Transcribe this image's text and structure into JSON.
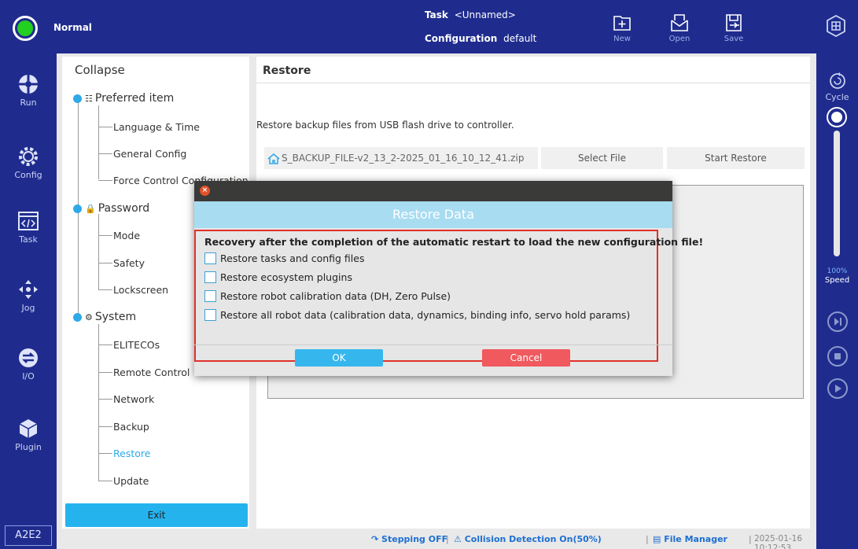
{
  "topbar": {
    "status": "Normal",
    "task_label": "Task",
    "task_value": "<Unnamed>",
    "config_label": "Configuration",
    "config_value": "default",
    "buttons": {
      "new": "New",
      "open": "Open",
      "save": "Save"
    }
  },
  "leftnav": {
    "items": [
      {
        "label": "Run",
        "icon": "run-icon"
      },
      {
        "label": "Config",
        "icon": "gear-icon"
      },
      {
        "label": "Task",
        "icon": "code-icon"
      },
      {
        "label": "Jog",
        "icon": "move-arrows-icon"
      },
      {
        "label": "I/O",
        "icon": "io-arrows-icon"
      },
      {
        "label": "Plugin",
        "icon": "cube-icon"
      }
    ],
    "version": "A2E2"
  },
  "rightnav": {
    "cycle": "Cycle",
    "speed_pct": "100%",
    "speed_label": "Speed",
    "speed_value": 1.0
  },
  "tree": {
    "title": "Collapse",
    "groups": [
      {
        "label": "Preferred item",
        "children": [
          "Language & Time",
          "General Config",
          "Force Control Configuration"
        ]
      },
      {
        "label": "Password",
        "children": [
          "Mode",
          "Safety",
          "Lockscreen"
        ]
      },
      {
        "label": "System",
        "children": [
          "ELITECOs",
          "Remote Control",
          "Network",
          "Backup",
          "Restore",
          "Update"
        ]
      }
    ],
    "exit": "Exit"
  },
  "main": {
    "title": "Restore",
    "description": "Restore backup files from USB flash drive to controller.",
    "file_path": "S_BACKUP_FILE-v2_13_2-2025_01_16_10_12_41.zip",
    "select_file": "Select File",
    "start_restore": "Start Restore"
  },
  "dialog": {
    "title": "Restore Data",
    "message": "Recovery after the completion of the automatic restart to load the new configuration file!",
    "options": [
      "Restore tasks and config files",
      "Restore ecosystem plugins",
      "Restore robot calibration data (DH, Zero Pulse)",
      "Restore all robot data (calibration data, dynamics, binding info, servo hold params)"
    ],
    "ok": "OK",
    "cancel": "Cancel"
  },
  "statusbar": {
    "stepping": "Stepping OFF",
    "collision": "Collision Detection On(50%)",
    "file_manager": "File Manager",
    "timestamp": "2025-01-16 10:12:53"
  },
  "colors": {
    "nav_bg": "#1f2c8e",
    "accent": "#2fa9e8",
    "status_green": "#22d11f",
    "cancel_red": "#f0595e",
    "highlight_red": "#e0312a"
  }
}
